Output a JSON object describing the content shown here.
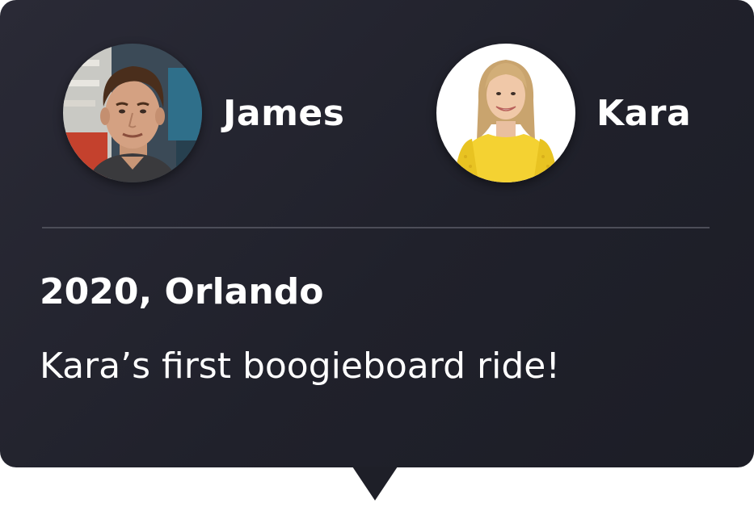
{
  "people": [
    {
      "name": "James",
      "avatar_icon": "avatar-photo-james"
    },
    {
      "name": "Kara",
      "avatar_icon": "avatar-photo-kara"
    }
  ],
  "memory": {
    "year_location": "2020, Orlando",
    "caption": "Kara’s first boogieboard ride!"
  },
  "colors": {
    "card_background": "#22232d",
    "divider": "#4c4d58",
    "text": "#ffffff"
  }
}
